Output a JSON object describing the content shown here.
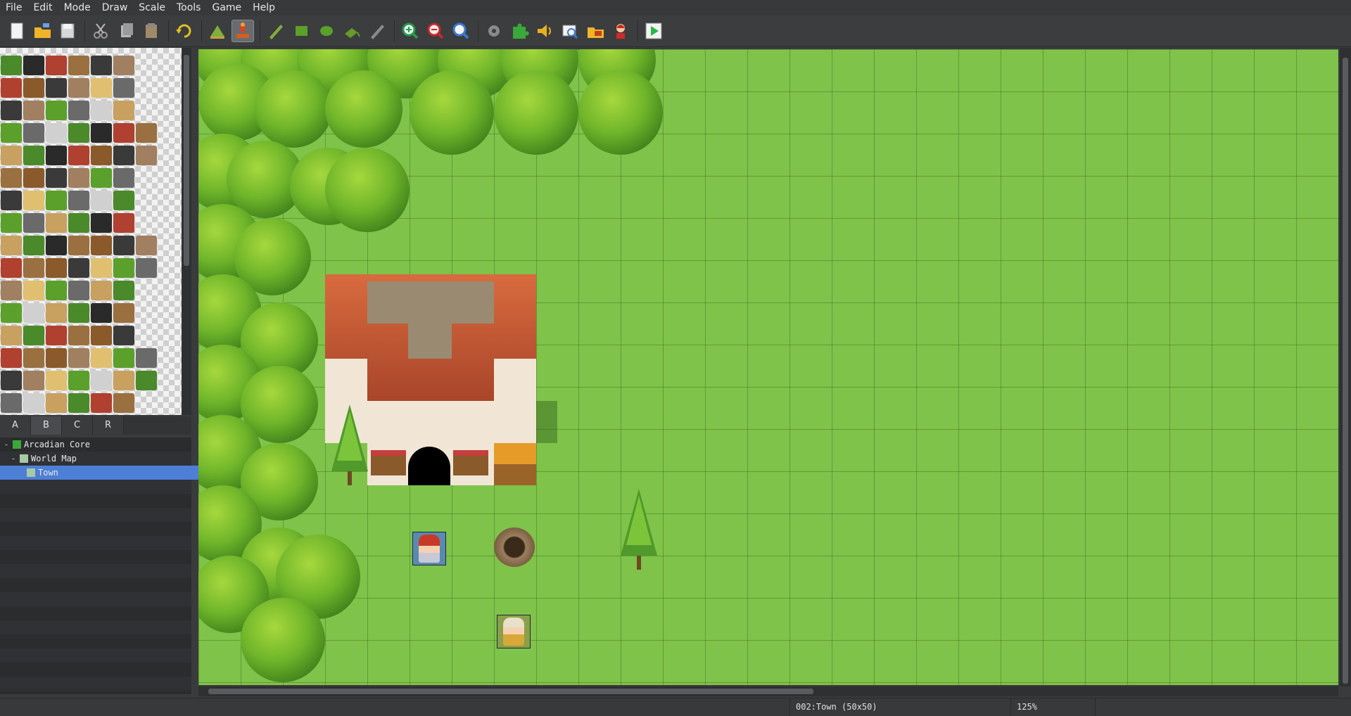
{
  "menu": [
    "File",
    "Edit",
    "Mode",
    "Draw",
    "Scale",
    "Tools",
    "Game",
    "Help"
  ],
  "toolbar": {
    "groups": [
      [
        "new-file-icon",
        "open-folder-icon",
        "save-icon"
      ],
      [
        "cut-icon",
        "copy-icon",
        "paste-icon"
      ],
      [
        "undo-icon"
      ],
      [
        "layer-map-icon",
        "layer-event-icon"
      ],
      [
        "pencil-icon",
        "rectangle-icon",
        "ellipse-icon",
        "fill-icon",
        "shadow-pen-icon"
      ],
      [
        "zoom-in-icon",
        "zoom-out-icon",
        "zoom-actual-icon"
      ],
      [
        "database-gear-icon",
        "plugin-puzzle-icon",
        "sound-icon",
        "event-search-icon",
        "resource-folder-icon",
        "character-generator-icon"
      ],
      [
        "playtest-icon"
      ]
    ],
    "active": [
      "layer-event-icon"
    ]
  },
  "tabs": [
    "A",
    "B",
    "C",
    "R"
  ],
  "tabs_active": "B",
  "map_tree": [
    {
      "label": "Arcadian Core",
      "toggle": "-",
      "indent": 0
    },
    {
      "label": "World Map",
      "toggle": "-",
      "indent": 1
    },
    {
      "label": "Town",
      "toggle": "",
      "indent": 2,
      "selected": true
    }
  ],
  "status": {
    "map_info": "002:Town (50x50)",
    "zoom": "125%"
  },
  "colors": {
    "grass": "#7fc34a",
    "selection": "#4d7fd6",
    "roof": "#c0532d"
  }
}
